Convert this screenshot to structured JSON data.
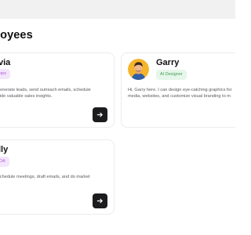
{
  "header": {
    "title": "loyees"
  },
  "employees": [
    {
      "name": "via",
      "role_badge": "ops",
      "description_lines": [
        "generate leads, send outreach emails, schedule",
        "vide valuable sales insights."
      ],
      "badge_color": "#f3e6fb"
    },
    {
      "name": "Garry",
      "role_badge": "AI Designer",
      "description_lines": [
        "Hi, Garry here. I can design eye-catching graphics for",
        "media, websites, and customize visual branding to m"
      ],
      "badge_color": "#e6f6ea"
    },
    {
      "name": "lly",
      "role_badge": "DA",
      "description_lines": [
        "schedule meetings, draft emails, and do market"
      ],
      "badge_color": "#f3e6fb"
    }
  ],
  "icons": {
    "arrow": "arrow-right-icon",
    "avatar": "avatar"
  },
  "colors": {
    "button": "#1c1c1e",
    "topbar": "#f1f1f2",
    "card_border": "#ececee"
  }
}
